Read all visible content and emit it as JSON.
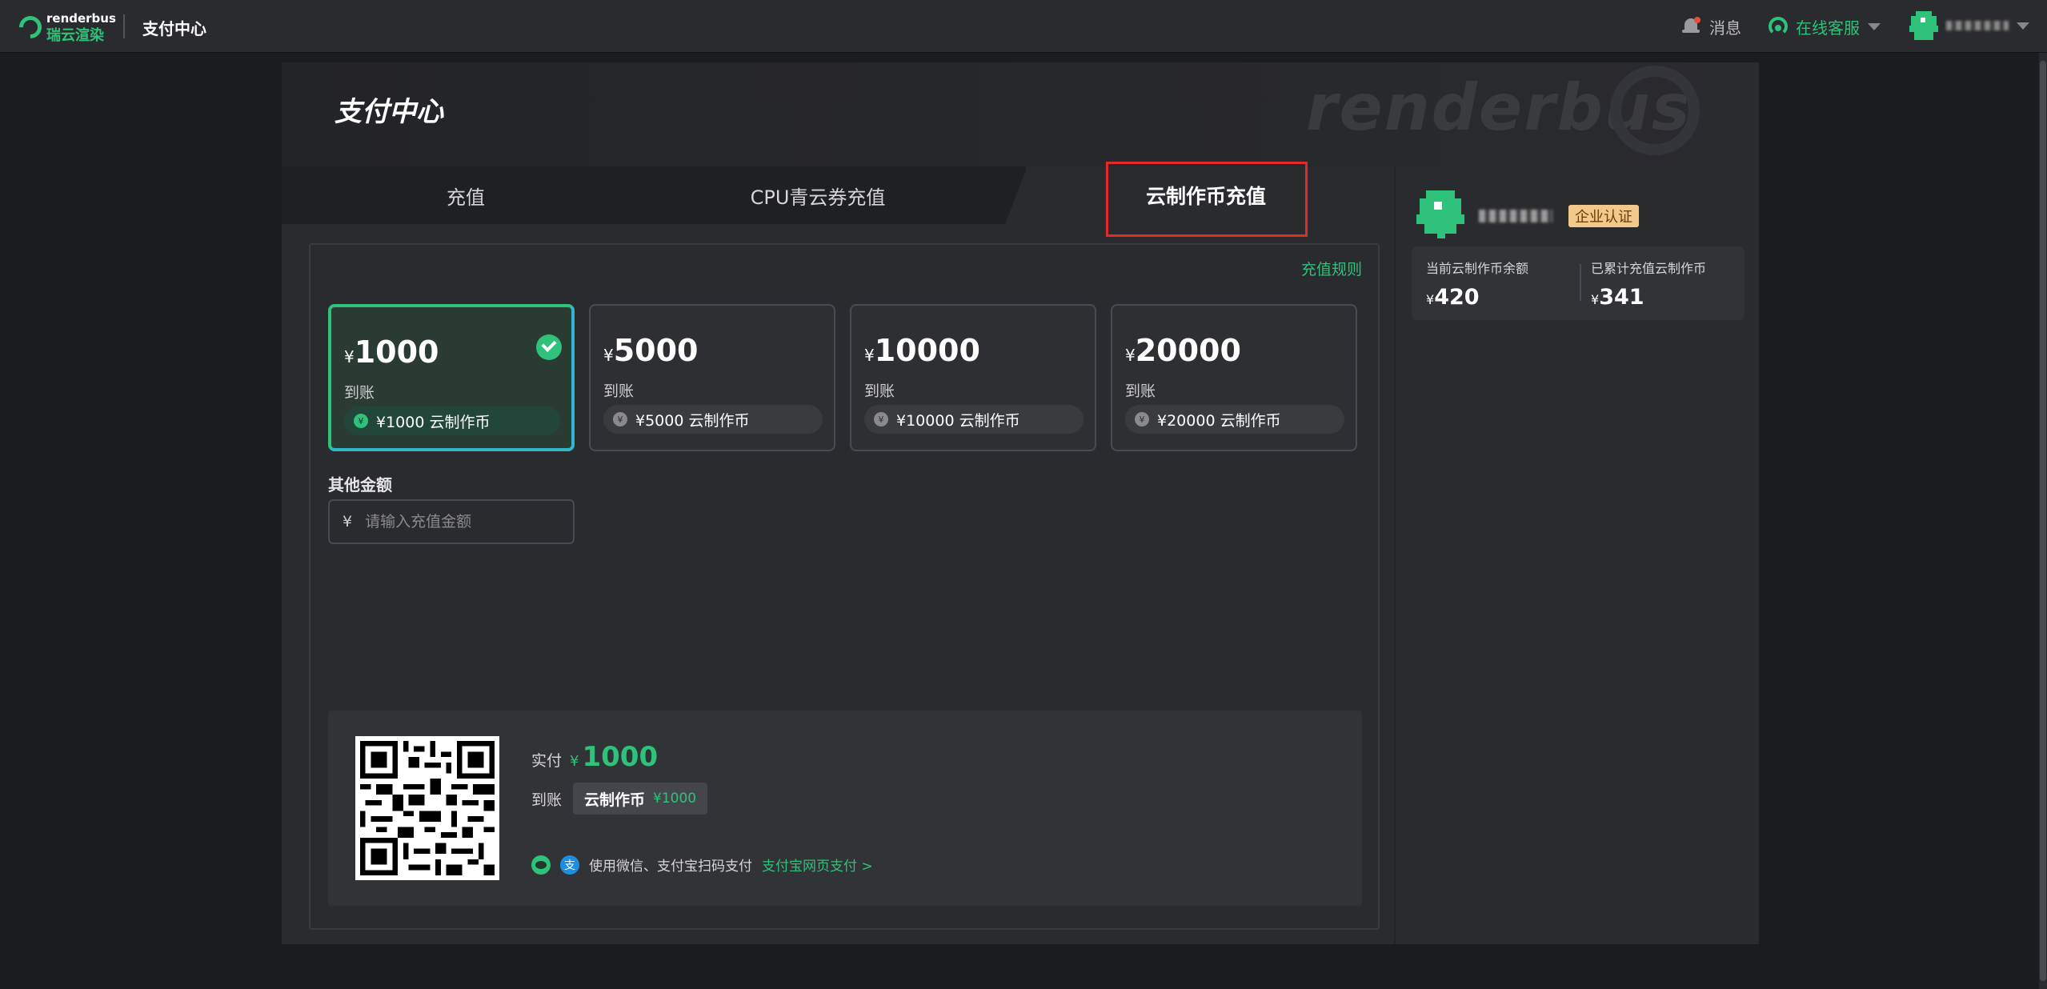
{
  "topbar": {
    "logo_en": "renderbus",
    "logo_cn": "瑞云渲染",
    "title": "支付中心",
    "messages_label": "消息",
    "service_label": "在线客服"
  },
  "page": {
    "title": "支付中心",
    "watermark": "renderbus"
  },
  "tabs": [
    {
      "label": "充值"
    },
    {
      "label": "CPU青云券充值"
    },
    {
      "label": "云制作币充值"
    }
  ],
  "rules_link": "充值规则",
  "cards": [
    {
      "yen": "¥",
      "amount": "1000",
      "arrive_label": "到账",
      "coin_text": "¥1000 云制作币",
      "selected": true
    },
    {
      "yen": "¥",
      "amount": "5000",
      "arrive_label": "到账",
      "coin_text": "¥5000 云制作币",
      "selected": false
    },
    {
      "yen": "¥",
      "amount": "10000",
      "arrive_label": "到账",
      "coin_text": "¥10000 云制作币",
      "selected": false
    },
    {
      "yen": "¥",
      "amount": "20000",
      "arrive_label": "到账",
      "coin_text": "¥20000 云制作币",
      "selected": false
    }
  ],
  "other_amount": {
    "label": "其他金额",
    "currency": "¥",
    "placeholder": "请输入充值金额",
    "value": ""
  },
  "payment": {
    "actual_label": "实付",
    "actual_yen": "¥",
    "actual_value": "1000",
    "arrive_label": "到账",
    "arrive_item": "云制作币",
    "arrive_amount": "¥1000",
    "methods_text": "使用微信、支付宝扫码支付",
    "alipay_link": "支付宝网页支付 >"
  },
  "account": {
    "badge": "企业认证",
    "balance_label": "当前云制作币余额",
    "balance_yen": "¥",
    "balance_value": "420",
    "total_label": "已累计充值云制作币",
    "total_yen": "¥",
    "total_value": "341"
  },
  "colors": {
    "accent": "#2fc27a",
    "highlight_box": "#e02b2b",
    "badge_bg": "#f3c98b"
  }
}
